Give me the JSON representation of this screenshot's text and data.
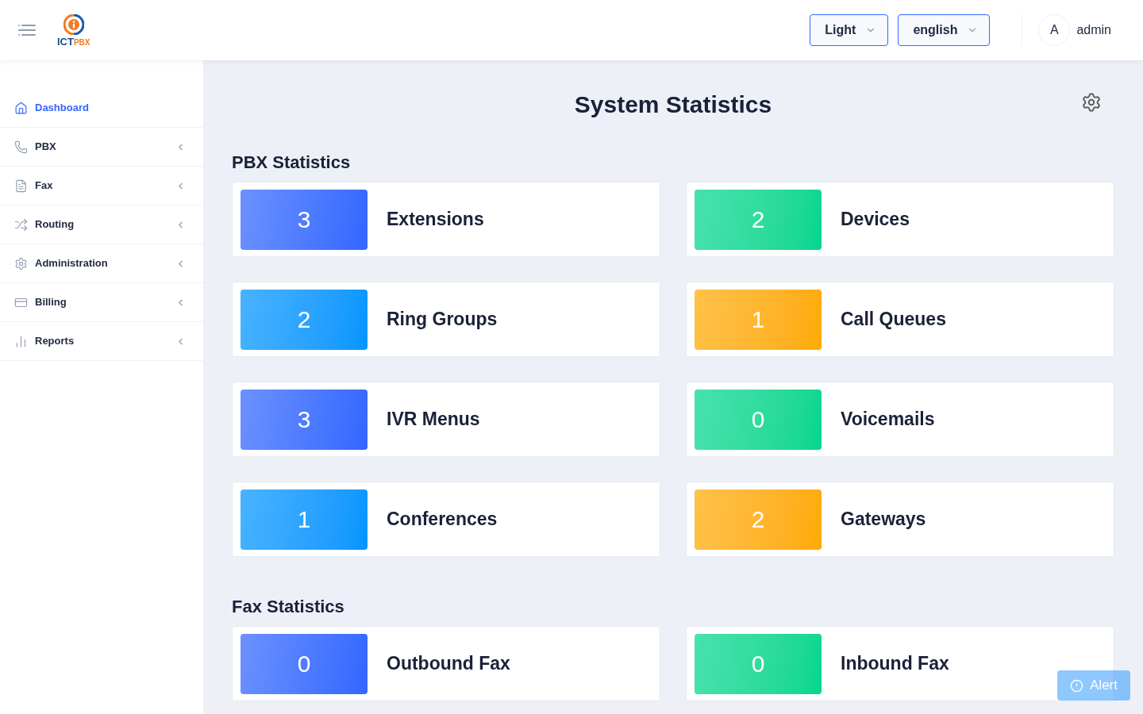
{
  "header": {
    "logo": {
      "text": "ICT",
      "accent": "PBX"
    },
    "selects": [
      {
        "value": "Light"
      },
      {
        "value": "english"
      }
    ],
    "user": {
      "initial": "A",
      "name": "admin"
    }
  },
  "sidebar": {
    "items": [
      {
        "label": "Dashboard",
        "kind": "link",
        "selected": true
      },
      {
        "label": "PBX",
        "kind": "menu",
        "selected": false
      },
      {
        "label": "Fax",
        "kind": "menu",
        "selected": false
      },
      {
        "label": "Routing",
        "kind": "menu",
        "selected": false
      },
      {
        "label": "Administration",
        "kind": "menu",
        "selected": false
      },
      {
        "label": "Billing",
        "kind": "menu",
        "selected": false
      },
      {
        "label": "Reports",
        "kind": "menu",
        "selected": false
      }
    ]
  },
  "main": {
    "title": "System Statistics",
    "sections": [
      {
        "title": "PBX Statistics",
        "cards": [
          {
            "count": "3",
            "label": "Extensions",
            "color": "#3366ff"
          },
          {
            "count": "2",
            "label": "Devices",
            "color": "#00d68f"
          },
          {
            "count": "2",
            "label": "Ring Groups",
            "color": "#0095ff"
          },
          {
            "count": "1",
            "label": "Call Queues",
            "color": "#ffaa00"
          },
          {
            "count": "3",
            "label": "IVR Menus",
            "color": "#3366ff"
          },
          {
            "count": "0",
            "label": "Voicemails",
            "color": "#00d68f"
          },
          {
            "count": "1",
            "label": "Conferences",
            "color": "#0095ff"
          },
          {
            "count": "2",
            "label": "Gateways",
            "color": "#ffaa00"
          }
        ]
      },
      {
        "title": "Fax Statistics",
        "cards": [
          {
            "count": "0",
            "label": "Outbound Fax",
            "color": "#3366ff"
          },
          {
            "count": "0",
            "label": "Inbound Fax",
            "color": "#00d68f"
          }
        ]
      }
    ]
  },
  "alert_button": {
    "label": "Alert"
  }
}
